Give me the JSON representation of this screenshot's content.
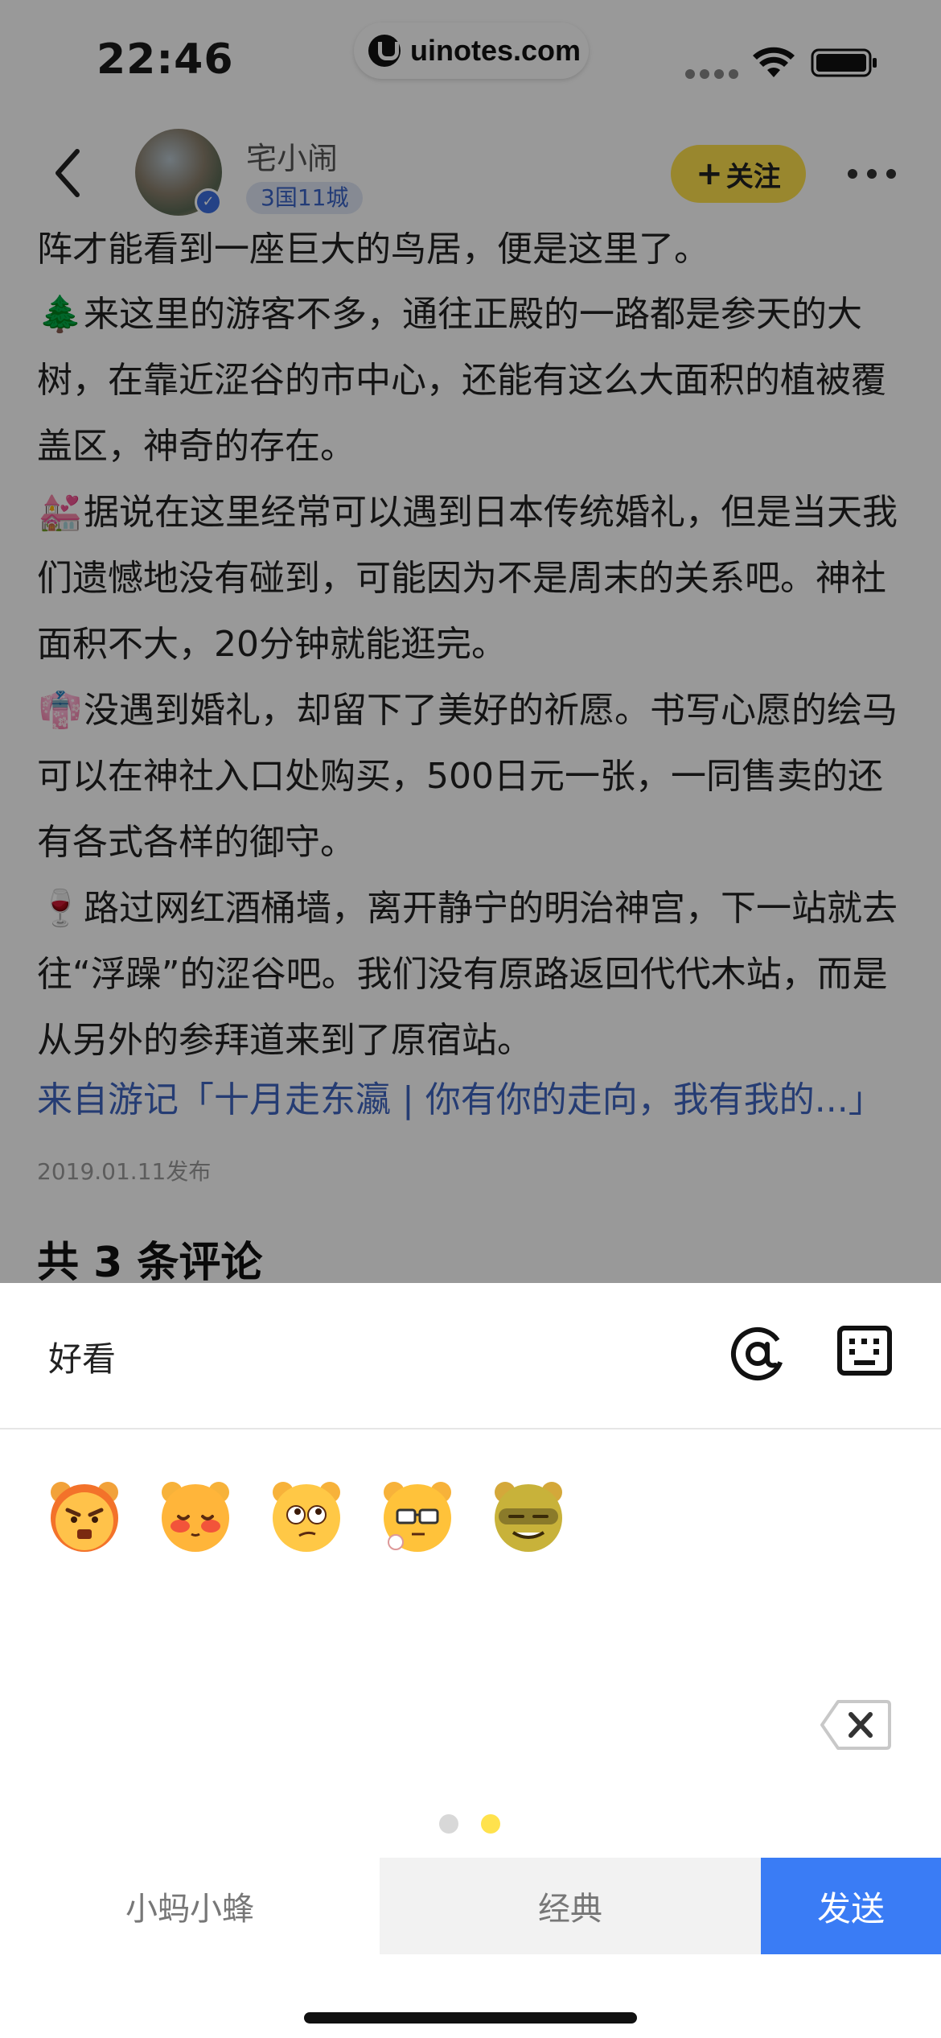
{
  "status_bar": {
    "time": "22:46",
    "url": "uinotes.com"
  },
  "nav": {
    "user_name": "宅小闹",
    "user_badge": "3国11城",
    "follow_label": "关注"
  },
  "article": {
    "cut_line": "阵才能看到一座巨大的鸟居，便是这里了。",
    "paragraphs": [
      {
        "emoji": "🌲",
        "text": "来这里的游客不多，通往正殿的一路都是参天的大树，在靠近涩谷的市中心，还能有这么大面积的植被覆盖区，神奇的存在。"
      },
      {
        "emoji": "💒",
        "text": "据说在这里经常可以遇到日本传统婚礼，但是当天我们遗憾地没有碰到，可能因为不是周末的关系吧。神社面积不大，20分钟就能逛完。"
      },
      {
        "emoji": "👘",
        "text": "没遇到婚礼，却留下了美好的祈愿。书写心愿的绘马可以在神社入口处购买，500日元一张，一同售卖的还有各式各样的御守。"
      },
      {
        "emoji": "🍷",
        "text": "路过网红酒桶墙，离开静宁的明治神宫，下一站就去往“浮躁”的涩谷吧。我们没有原路返回代代木站，而是从另外的参拜道来到了原宿站。"
      }
    ],
    "from_link": "来自游记「十月走东瀛 | 你有你的走向，我有我的...」",
    "publish_date": "2019.01.11发布",
    "comments_title": "共 3 条评论"
  },
  "comment_sheet": {
    "input_value": "好看",
    "emojis": [
      "angry-bear-emoji",
      "shy-bear-emoji",
      "thinking-bear-emoji",
      "nerd-bear-emoji",
      "smirk-bear-emoji"
    ],
    "page_count": 2,
    "active_page": 2,
    "tabs": [
      "小蚂小蜂",
      "经典"
    ],
    "send_label": "发送"
  },
  "colors": {
    "accent_yellow": "#ffe24d",
    "send_blue": "#3a7cf5",
    "link_blue": "#3e64c0"
  }
}
